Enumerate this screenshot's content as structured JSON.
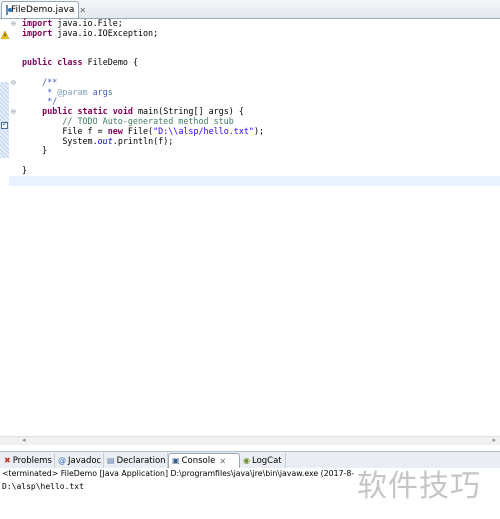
{
  "editor": {
    "tab_label": "FileDemo.java",
    "code_lines": [
      [
        {
          "t": "import ",
          "c": "kw"
        },
        {
          "t": "java.io.File;",
          "c": "plain"
        }
      ],
      [
        {
          "t": "import ",
          "c": "kw"
        },
        {
          "t": "java.io.IOException;",
          "c": "plain"
        }
      ],
      [],
      [],
      [
        {
          "t": "public ",
          "c": "kw"
        },
        {
          "t": "class ",
          "c": "kw"
        },
        {
          "t": "FileDemo {",
          "c": "plain"
        }
      ],
      [],
      [
        {
          "t": "    /**",
          "c": "jd"
        }
      ],
      [
        {
          "t": "     * ",
          "c": "jd"
        },
        {
          "t": "@param",
          "c": "ann"
        },
        {
          "t": " args",
          "c": "jd"
        }
      ],
      [
        {
          "t": "     */",
          "c": "jd"
        }
      ],
      [
        {
          "t": "    public ",
          "c": "kw"
        },
        {
          "t": "static ",
          "c": "kw"
        },
        {
          "t": "void ",
          "c": "kw"
        },
        {
          "t": "main(String[] args) {",
          "c": "plain"
        }
      ],
      [
        {
          "t": "        // TODO Auto-generated method stub",
          "c": "cm"
        }
      ],
      [
        {
          "t": "        File f = ",
          "c": "plain"
        },
        {
          "t": "new ",
          "c": "kw"
        },
        {
          "t": "File(",
          "c": "plain"
        },
        {
          "t": "\"D:\\\\alsp/hello.txt\"",
          "c": "str"
        },
        {
          "t": ");",
          "c": "plain"
        }
      ],
      [
        {
          "t": "        System.",
          "c": "plain"
        },
        {
          "t": "out",
          "c": "fld"
        },
        {
          "t": ".println(f);",
          "c": "plain"
        }
      ],
      [
        {
          "t": "    }",
          "c": "plain"
        }
      ],
      [],
      [
        {
          "t": "}",
          "c": "plain"
        }
      ],
      []
    ]
  },
  "panel_tabs": [
    {
      "label": "Problems",
      "icon": "problems-icon",
      "glyph": "✖",
      "color": "#c0392b"
    },
    {
      "label": "Javadoc",
      "icon": "javadoc-icon",
      "glyph": "@",
      "color": "#2c6fbb"
    },
    {
      "label": "Declaration",
      "icon": "declaration-icon",
      "glyph": "▤",
      "color": "#5b7fa8"
    },
    {
      "label": "Console",
      "icon": "console-icon",
      "glyph": "▣",
      "color": "#3a5f8a",
      "active": true
    },
    {
      "label": "LogCat",
      "icon": "logcat-icon",
      "glyph": "◉",
      "color": "#6b8e23"
    }
  ],
  "console": {
    "header": "<terminated> FileDemo [Java Application] D:\\programfiles\\java\\jre\\bin\\javaw.exe (2017-8-",
    "output": "D:\\alsp\\hello.txt"
  },
  "watermark": "软件技巧"
}
